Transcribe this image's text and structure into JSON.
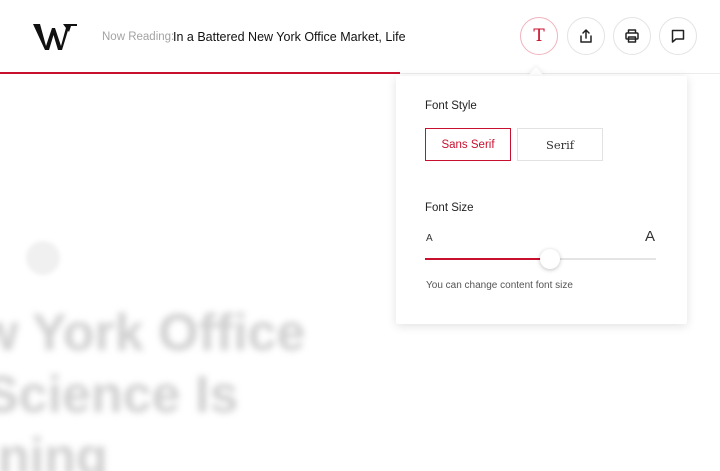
{
  "header": {
    "now_reading_label": "Now Reading:",
    "article_title": "In a Battered New York Office Market, Life",
    "reading_progress": 0.555,
    "buttons": [
      {
        "name": "font-settings-button",
        "icon": "font-icon",
        "glyph": "T"
      },
      {
        "name": "share-button",
        "icon": "share-icon"
      },
      {
        "name": "print-button",
        "icon": "print-icon"
      },
      {
        "name": "comment-button",
        "icon": "comment-icon"
      }
    ]
  },
  "background_article": {
    "headline_lines": [
      "w York Office",
      "Science Is",
      "ning"
    ]
  },
  "font_panel": {
    "font_style_label": "Font Style",
    "style_options": [
      {
        "label": "Sans Serif",
        "selected": true
      },
      {
        "label": "Serif",
        "selected": false
      }
    ],
    "font_size_label": "Font Size",
    "size_small_label": "A",
    "size_large_label": "A",
    "font_size_level": 0.54,
    "hint": "You can change content font size"
  },
  "colors": {
    "accent": "#c8102e",
    "title_text": "#111111",
    "muted_text": "#a3a3a3"
  }
}
